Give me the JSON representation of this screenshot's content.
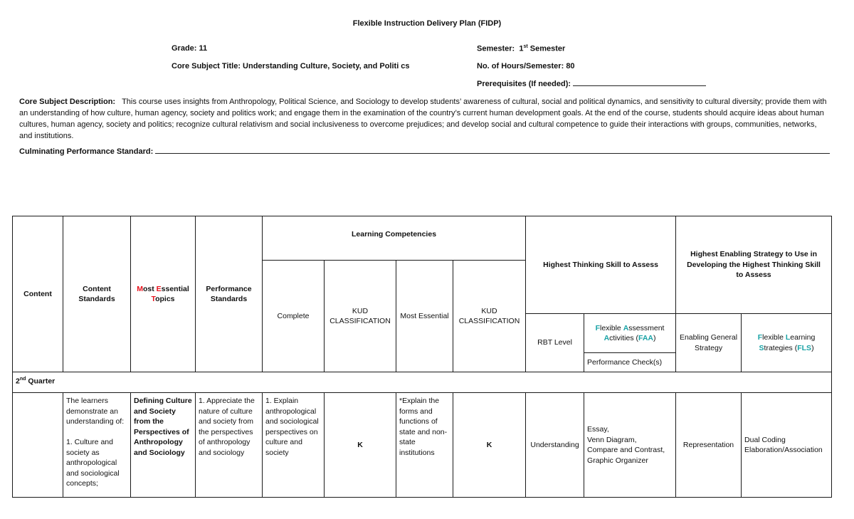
{
  "document": {
    "title": "Flexible Instruction Delivery Plan (FIDP)",
    "grade_label": "Grade:",
    "grade_value": "11",
    "core_subject_title_label": "Core Subject Title:",
    "core_subject_title_value": "Understanding Culture, Society, and Politi cs",
    "semester_label": "Semester:",
    "semester_num": "1",
    "semester_sup": "st",
    "semester_word": "Semester",
    "hours_label": "No. of Hours/Semester:",
    "hours_value": "80",
    "prereq_label": "Prerequisites (If needed):",
    "prereq_value": "",
    "description_label": "Core Subject Description:",
    "description_text": "This course uses insights from Anthropology, Political Science, and Sociology to develop students’ awareness of cultural, social and political dynamics, and sensitivity to cultural diversity; provide them with an understanding of how culture, human agency, society and politics work; and engage them in the examination of the country’s current human development goals. At the end of the course, students should acquire ideas about human cultures, human agency, society and politics; recognize cultural relativism and social inclusiveness to overcome prejudices; and develop social and cultural competence to guide their interactions with groups, communities, networks, and institutions.",
    "culminating_label": "Culminating Performance Standard:",
    "culminating_value": ""
  },
  "colors": {
    "accent_red": "#e8101a",
    "accent_teal": "#1aa3a6",
    "border": "#1a1a1a"
  },
  "table": {
    "headers": {
      "content": "Content",
      "content_standards": "Content Standards",
      "most_essential_topics": {
        "m": "M",
        "ost": "ost ",
        "e": "E",
        "ssential": "ssential",
        "t": "T",
        "opics": "opics"
      },
      "performance_standards": "Performance Standards",
      "learning_competencies": "Learning Competencies",
      "complete": "Complete",
      "kud_classification_1": "KUD CLASSIFICATION",
      "most_essential": "Most Essential",
      "kud_classification_2": "KUD CLASSIFICATION",
      "highest_thinking_skill": "Highest Thinking Skill to Assess",
      "highest_enabling_strategy": "Highest Enabling Strategy to Use in Developing the Highest Thinking Skill to Assess",
      "rbt_level": "RBT Level",
      "faa": {
        "f": "F",
        "lexible": "lexible ",
        "a1": "A",
        "ssessment": "ssessment",
        "a2": "A",
        "ctivities": "ctivities (",
        "abbr": "FAA",
        "close": ")"
      },
      "performance_checks": "Performance Check(s)",
      "enabling_general_strategy": "Enabling General Strategy",
      "fls": {
        "f": "F",
        "lexible": "lexible ",
        "l": "L",
        "earning": "earning",
        "s": "S",
        "trategies": "trategies (",
        "abbr": "FLS",
        "close": ")"
      }
    },
    "quarter": {
      "num": "2",
      "sup": "nd",
      "label": "Quarter"
    },
    "rows": [
      {
        "content": "",
        "content_standards_intro": "The learners demonstrate an understanding of:",
        "content_standards_item": "1. Culture and society as anthropological and sociological concepts;",
        "most_essential_topic": "Defining Culture and Society from the Perspectives of Anthropology and Sociology",
        "performance_standards": "1. Appreciate the nature of culture and society from the perspectives of anthropology and sociology",
        "complete": "1. Explain anthropological and sociological perspectives on culture and society",
        "kud_1": "K",
        "most_essential": "*Explain the forms and functions of state and non-state institutions",
        "kud_2": "K",
        "rbt_level": "Understanding",
        "faa_lines": [
          "Essay,",
          "Venn Diagram,",
          "Compare and Contrast,",
          "Graphic Organizer"
        ],
        "enabling_general_strategy": "Representation",
        "fls_lines": [
          "Dual Coding",
          "Elaboration/Association"
        ]
      }
    ]
  }
}
